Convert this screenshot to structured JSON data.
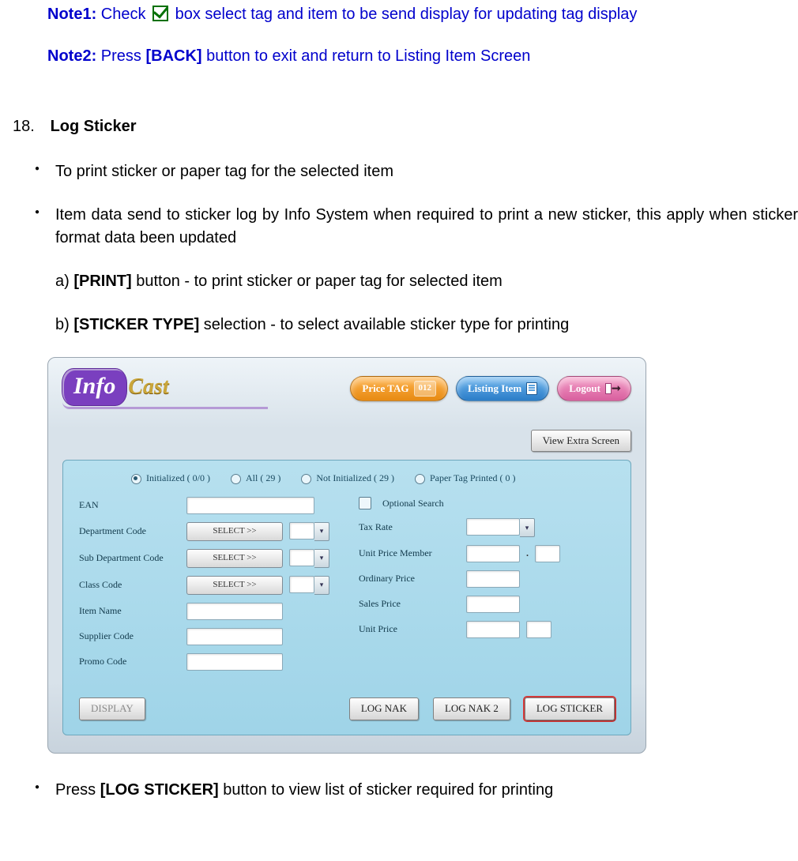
{
  "notes": {
    "note1_label": "Note1:",
    "note1_a": " Check ",
    "note1_b": " box select tag and item to be send display for updating tag display",
    "note2_label": "Note2:",
    "note2_a": " Press ",
    "note2_back": "[BACK]",
    "note2_b": " button to exit and return to Listing Item Screen"
  },
  "section": {
    "number": "18.",
    "title": "Log Sticker"
  },
  "bullets": {
    "b1": "To print sticker or paper tag for the selected item",
    "b2": "Item data send to sticker log by Info System when required to print a new sticker, this apply when sticker format data been updated",
    "b3_a": "Press ",
    "b3_btn": "[LOG STICKER]",
    "b3_b": " button to view list of sticker required for printing"
  },
  "subs": {
    "a_pre": "a) ",
    "a_btn": "[PRINT]",
    "a_post": " button - to print sticker or paper tag for selected item",
    "b_pre": "b) ",
    "b_btn": "[STICKER TYPE]",
    "b_post": " selection - to select available sticker type for printing"
  },
  "shot": {
    "logo_info": "Info",
    "logo_cast": "Cast",
    "pill_price": "Price TAG",
    "pill_price_badge": "012",
    "pill_listing": "Listing Item",
    "pill_logout": "Logout",
    "btn_view_extra": "View Extra Screen",
    "radios": {
      "r1": "Initialized ( 0/0 )",
      "r2": "All  ( 29 )",
      "r3": "Not Initialized  ( 29 )",
      "r4": "Paper Tag Printed  ( 0 )"
    },
    "labels": {
      "ean": "EAN",
      "dept": "Department Code",
      "subdept": "Sub Department Code",
      "class": "Class Code",
      "item": "Item Name",
      "supplier": "Supplier Code",
      "promo": "Promo Code",
      "optsearch": "Optional Search",
      "tax": "Tax Rate",
      "upm": "Unit Price Member",
      "ord": "Ordinary Price",
      "sales": "Sales Price",
      "unit": "Unit Price"
    },
    "select_label": "SELECT >>",
    "upm_dot": ".",
    "actions": {
      "display": "DISPLAY",
      "lognak": "LOG NAK",
      "lognak2": "LOG NAK 2",
      "logsticker": "LOG STICKER"
    }
  }
}
